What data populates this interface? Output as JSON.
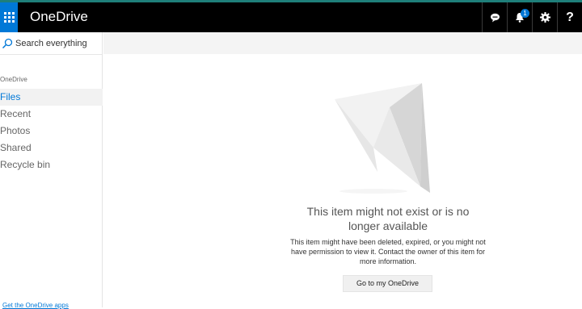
{
  "app": {
    "title": "OneDrive"
  },
  "topbar": {
    "notification_count": "1",
    "help_label": "?"
  },
  "sidebar": {
    "search_placeholder": "Search everything",
    "section_label": "OneDrive",
    "items": [
      {
        "label": "Files",
        "active": true
      },
      {
        "label": "Recent"
      },
      {
        "label": "Photos"
      },
      {
        "label": "Shared"
      },
      {
        "label": "Recycle bin"
      }
    ],
    "footer_link": "Get the OneDrive apps"
  },
  "error": {
    "title": "This item might not exist or is no longer available",
    "description": "This item might have been deleted, expired, or you might not have permission to view it. Contact the owner of this item for more information.",
    "button_label": "Go to my OneDrive"
  },
  "colors": {
    "accent": "#0078d7",
    "topbar": "#000000",
    "topbar_strip": "#1f7f7a"
  },
  "icons": [
    "app-launcher-icon",
    "chat-icon",
    "bell-icon",
    "gear-icon",
    "help-icon",
    "search-icon",
    "paper-plane-icon"
  ]
}
